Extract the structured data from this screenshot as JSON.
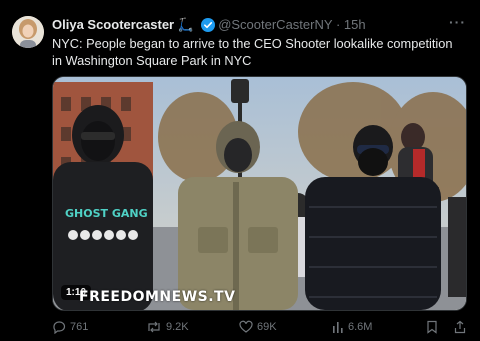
{
  "tweet": {
    "author_name": "Oliya Scootercaster",
    "author_emoji": "🛴",
    "handle": "@ScooterCasterNY",
    "separator": "·",
    "time": "15h",
    "text": "NYC: People began to arrive to the CEO Shooter lookalike competition in Washington Square Park in NYC",
    "more_icon": "more-icon",
    "verified_color": "#1d9bf0"
  },
  "media": {
    "duration": "1:10",
    "watermark": "FREEDOMNEWS.TV",
    "sweatshirt_print": "GHOST GANG"
  },
  "actions": {
    "replies": "761",
    "reposts": "9.2K",
    "likes": "69K",
    "views": "6.6M"
  },
  "colors": {
    "background": "#000000",
    "text_primary": "#e7e9ea",
    "text_secondary": "#71767b"
  }
}
